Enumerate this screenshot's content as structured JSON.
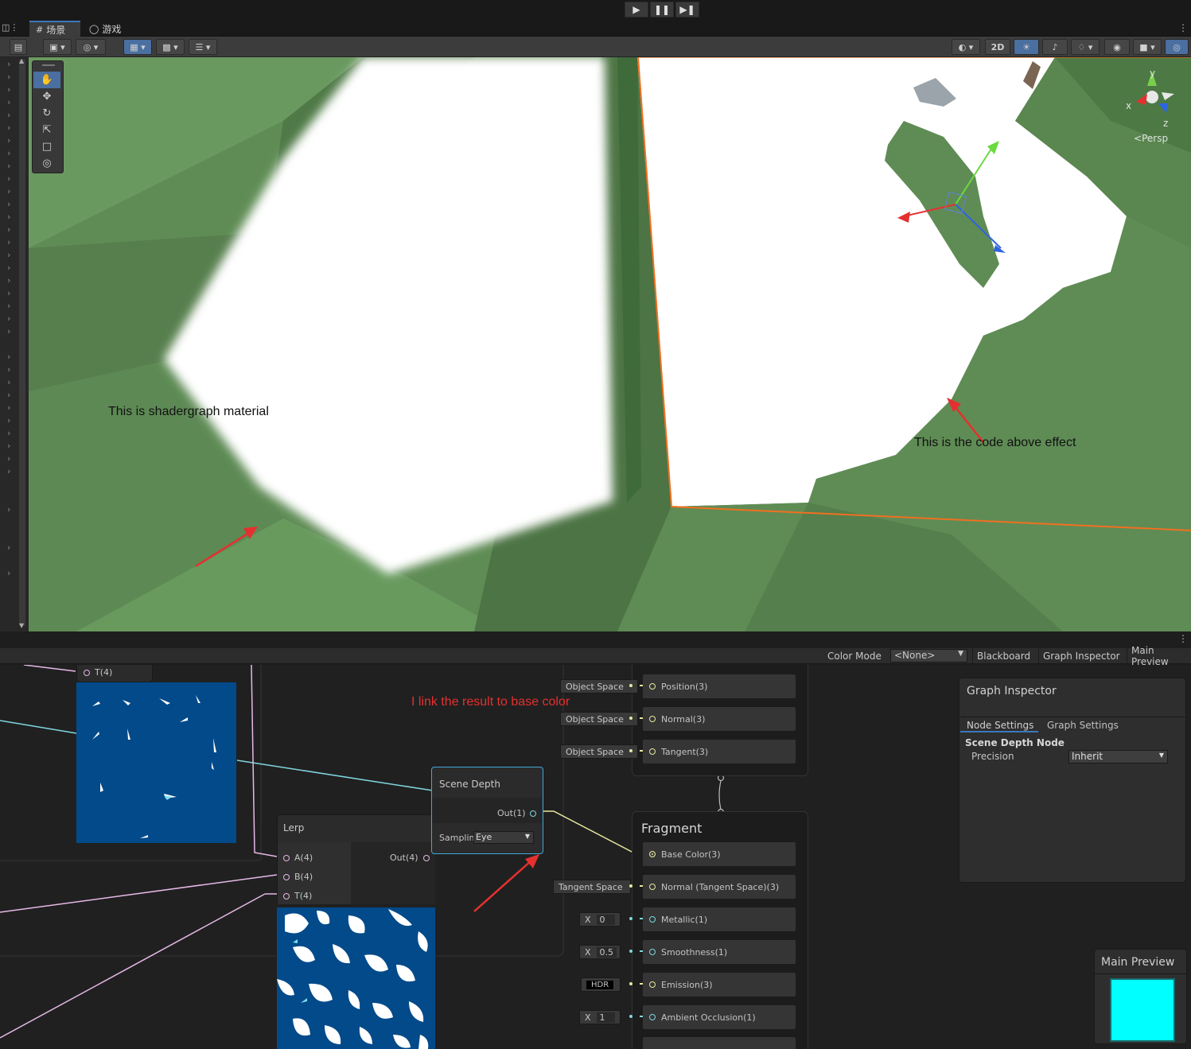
{
  "top_bar": {
    "play_icon": "play-icon",
    "pause_icon": "pause-icon",
    "step_icon": "step-icon"
  },
  "tabs": {
    "scene": "场景",
    "game": "游戏"
  },
  "scene_toolbar": {
    "mode_2d": "2D",
    "colors": {
      "accent": "#3a79bb",
      "active_tool": "#4a6fa0"
    }
  },
  "viewport": {
    "annotation_left": "This is shadergraph material",
    "annotation_right": "This is the code above effect",
    "persp_label": "Persp",
    "gizmo_axes": {
      "y": "y",
      "x": "x",
      "z": "z"
    },
    "colors": {
      "grass": "#5f8c55",
      "selection": "#f07020",
      "arrow": "#e53030"
    }
  },
  "shader_graph": {
    "color_mode_label": "Color Mode",
    "color_mode_value": "<None>",
    "blackboard": "Blackboard",
    "graph_inspector": "Graph Inspector",
    "main_preview": "Main Preview",
    "annotation": "I link the result to base color",
    "top_partial_port": "T(4)",
    "lerp": {
      "title": "Lerp",
      "inputs": [
        "A(4)",
        "B(4)",
        "T(4)"
      ],
      "output": "Out(4)"
    },
    "scene_depth": {
      "title": "Scene Depth",
      "output": "Out(1)",
      "sampling_label": "Samplin",
      "sampling_value": "Eye"
    },
    "vertex": {
      "ports": [
        {
          "space": "Object Space",
          "label": "Position(3)"
        },
        {
          "space": "Object Space",
          "label": "Normal(3)"
        },
        {
          "space": "Object Space",
          "label": "Tangent(3)"
        }
      ]
    },
    "fragment": {
      "title": "Fragment",
      "ports": [
        {
          "input": "",
          "label": "Base Color(3)"
        },
        {
          "input": "Tangent Space",
          "label": "Normal (Tangent Space)(3)"
        },
        {
          "input_prefix": "X",
          "input": "0",
          "label": "Metallic(1)"
        },
        {
          "input_prefix": "X",
          "input": "0.5",
          "label": "Smoothness(1)"
        },
        {
          "input": "HDR",
          "label": "Emission(3)"
        },
        {
          "input_prefix": "X",
          "input": "1",
          "label": "Ambient Occlusion(1)"
        }
      ]
    },
    "inspector": {
      "title": "Graph Inspector",
      "tab_node": "Node Settings",
      "tab_graph": "Graph Settings",
      "node_name": "Scene Depth Node",
      "precision_label": "Precision",
      "precision_value": "Inherit"
    },
    "preview": {
      "title": "Main Preview",
      "color": "#00ffff"
    },
    "colors": {
      "texture_blue": "#034a8a",
      "edge_cyan": "#7fd6e0",
      "edge_pink": "#e6b8e6",
      "edge_yellow": "#e8e8a0"
    }
  }
}
